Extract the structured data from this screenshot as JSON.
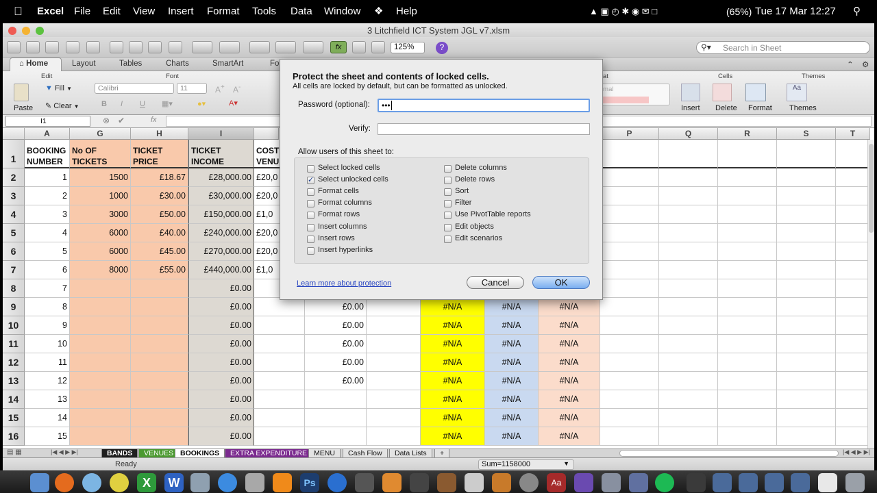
{
  "menubar": {
    "apple": "",
    "app": "Excel",
    "items": [
      "File",
      "Edit",
      "View",
      "Insert",
      "Format",
      "Tools",
      "Data",
      "Window",
      "Help"
    ],
    "battery": "(65%)",
    "clock": "Tue 17 Mar  12:27"
  },
  "window": {
    "title": "3 Litchfield ICT System JGL v7.xlsm"
  },
  "toolbar": {
    "zoom": "125%",
    "search_placeholder": "Search in Sheet"
  },
  "ribbon": {
    "tabs": [
      "Home",
      "Layout",
      "Tables",
      "Charts",
      "SmartArt",
      "Fo"
    ],
    "right_tab_fragment": "at",
    "groups": {
      "edit": "Edit",
      "font": "Font",
      "cells": "Cells",
      "themes": "Themes"
    },
    "paste": "Paste",
    "fill": "Fill",
    "clear": "Clear",
    "font_name": "Calibri",
    "font_size": "11",
    "normal": "rmal",
    "insert": "Insert",
    "delete": "Delete",
    "format": "Format",
    "themes_btn": "Themes"
  },
  "formula_bar": {
    "name_box": "I1",
    "fx": "fx"
  },
  "columns": [
    "A",
    "G",
    "H",
    "I",
    "",
    "",
    "",
    "",
    "",
    "",
    "P",
    "Q",
    "R",
    "S",
    "T"
  ],
  "headers": {
    "a": "BOOKING NUMBER",
    "g": "No OF TICKETS SOLD",
    "h": "TICKET PRICE",
    "i": "TICKET INCOME",
    "j": "COST O VENUE"
  },
  "rows": [
    {
      "n": "1"
    },
    {
      "n": "2",
      "a": "1",
      "g": "1500",
      "h": "£18.67",
      "i": "£28,000.00",
      "j": "£20,0"
    },
    {
      "n": "3",
      "a": "2",
      "g": "1000",
      "h": "£30.00",
      "i": "£30,000.00",
      "j": "£20,0"
    },
    {
      "n": "4",
      "a": "3",
      "g": "3000",
      "h": "£50.00",
      "i": "£150,000.00",
      "j": "£1,0"
    },
    {
      "n": "5",
      "a": "4",
      "g": "6000",
      "h": "£40.00",
      "i": "£240,000.00",
      "j": "£20,0"
    },
    {
      "n": "6",
      "a": "5",
      "g": "6000",
      "h": "£45.00",
      "i": "£270,000.00",
      "j": "£20,0"
    },
    {
      "n": "7",
      "a": "6",
      "g": "8000",
      "h": "£55.00",
      "i": "£440,000.00",
      "j": "£1,0"
    },
    {
      "n": "8",
      "a": "7",
      "i": "£0.00"
    },
    {
      "n": "9",
      "a": "8",
      "i": "£0.00",
      "k": "£0.00",
      "m": "#N/A",
      "n2": "#N/A",
      "o": "#N/A"
    },
    {
      "n": "10",
      "a": "9",
      "i": "£0.00",
      "k": "£0.00",
      "m": "#N/A",
      "n2": "#N/A",
      "o": "#N/A"
    },
    {
      "n": "11",
      "a": "10",
      "i": "£0.00",
      "k": "£0.00",
      "m": "#N/A",
      "n2": "#N/A",
      "o": "#N/A"
    },
    {
      "n": "12",
      "a": "11",
      "i": "£0.00",
      "k": "£0.00",
      "m": "#N/A",
      "n2": "#N/A",
      "o": "#N/A"
    },
    {
      "n": "13",
      "a": "12",
      "i": "£0.00",
      "k": "£0.00",
      "m": "#N/A",
      "n2": "#N/A",
      "o": "#N/A"
    },
    {
      "n": "14",
      "a": "13",
      "i": "£0.00",
      "m": "#N/A",
      "n2": "#N/A",
      "o": "#N/A"
    },
    {
      "n": "15",
      "a": "14",
      "i": "£0.00",
      "m": "#N/A",
      "n2": "#N/A",
      "o": "#N/A"
    },
    {
      "n": "16",
      "a": "15",
      "i": "£0.00",
      "m": "#N/A",
      "n2": "#N/A",
      "o": "#N/A"
    }
  ],
  "sheet_tabs": [
    "BANDS",
    "VENUES",
    "BOOKINGS",
    "EXTRA EXPENDITURE",
    "MENU",
    "Cash Flow",
    "Data Lists",
    "+"
  ],
  "status": {
    "ready": "Ready",
    "sum": "Sum=1158000"
  },
  "dialog": {
    "title": "Protect the sheet and contents of locked cells.",
    "subtitle": "All cells are locked by default, but can be formatted as unlocked.",
    "password_label": "Password (optional):",
    "password_value": "•••",
    "verify_label": "Verify:",
    "allow_label": "Allow users of this sheet to:",
    "options_left": [
      {
        "label": "Select locked cells",
        "checked": false
      },
      {
        "label": "Select unlocked cells",
        "checked": true
      },
      {
        "label": "Format cells",
        "checked": false
      },
      {
        "label": "Format columns",
        "checked": false
      },
      {
        "label": "Format rows",
        "checked": false
      },
      {
        "label": "Insert columns",
        "checked": false
      },
      {
        "label": "Insert rows",
        "checked": false
      },
      {
        "label": "Insert hyperlinks",
        "checked": false
      }
    ],
    "options_right": [
      {
        "label": "Delete columns",
        "checked": false
      },
      {
        "label": "Delete rows",
        "checked": false
      },
      {
        "label": "Sort",
        "checked": false
      },
      {
        "label": "Filter",
        "checked": false
      },
      {
        "label": "Use PivotTable reports",
        "checked": false
      },
      {
        "label": "Edit objects",
        "checked": false
      },
      {
        "label": "Edit scenarios",
        "checked": false
      }
    ],
    "learn_more": "Learn more about protection",
    "cancel": "Cancel",
    "ok": "OK"
  },
  "colors": {
    "salmon": "#f9c9ab",
    "tan": "#ddd9d2",
    "yellow": "#ffff00",
    "blue": "#c9d9f0",
    "peach": "#fbdccb",
    "accent": "#3b7be0"
  }
}
